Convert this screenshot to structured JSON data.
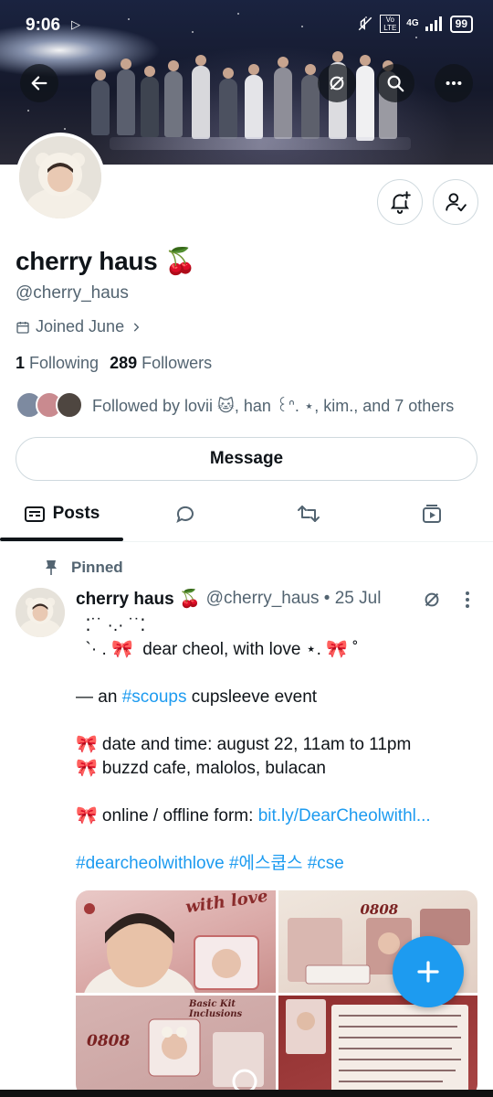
{
  "status_bar": {
    "time": "9:06",
    "network": "4G",
    "lte": "Vo LTE",
    "battery": "99"
  },
  "profile": {
    "display_name": "cherry haus",
    "name_emoji": "🍒",
    "handle": "@cherry_haus",
    "joined": "Joined June",
    "following_count": "1",
    "following_label": "Following",
    "followers_count": "289",
    "followers_label": "Followers",
    "followed_by": "Followed by lovii 🐱, han ꒰ᐢ. ⋆, kim., and 7 others",
    "message_label": "Message"
  },
  "tabs": [
    {
      "label": "Posts",
      "icon": "posts-icon"
    },
    {
      "label": "",
      "icon": "replies-icon"
    },
    {
      "label": "",
      "icon": "retweet-icon"
    },
    {
      "label": "",
      "icon": "media-icon"
    }
  ],
  "post": {
    "pinned_label": "Pinned",
    "author": "cherry haus 🍒",
    "handle_date": "@cherry_haus • 25 Jul",
    "lines": [
      "  ⁚˙˙ ·.· ˙˙⁚",
      "  `· . 🎀  dear cheol, with love ⋆. 🎀 ˚",
      "",
      "— an ",
      "",
      "🎀 date and time: august 22, 11am to 11pm",
      "🎀 buzzd cafe, malolos, bulacan",
      "",
      "🎀 online / offline form: ",
      "",
      ""
    ],
    "event_prefix": "— an ",
    "event_hashtag": "#scoups",
    "event_suffix": " cupsleeve event",
    "form_prefix": "🎀 online / offline form: ",
    "form_link": "bit.ly/DearCheolwithl...",
    "hashtags": "#dearcheolwithlove #에스쿱스 #cse",
    "media_texts": {
      "with_love": "with love",
      "date_a": "0808",
      "date_b": "0808",
      "kit_title": "Basic Kit Inclusions"
    }
  },
  "colors": {
    "accent": "#1d9bf0",
    "text": "#0f1419",
    "muted": "#536471"
  }
}
